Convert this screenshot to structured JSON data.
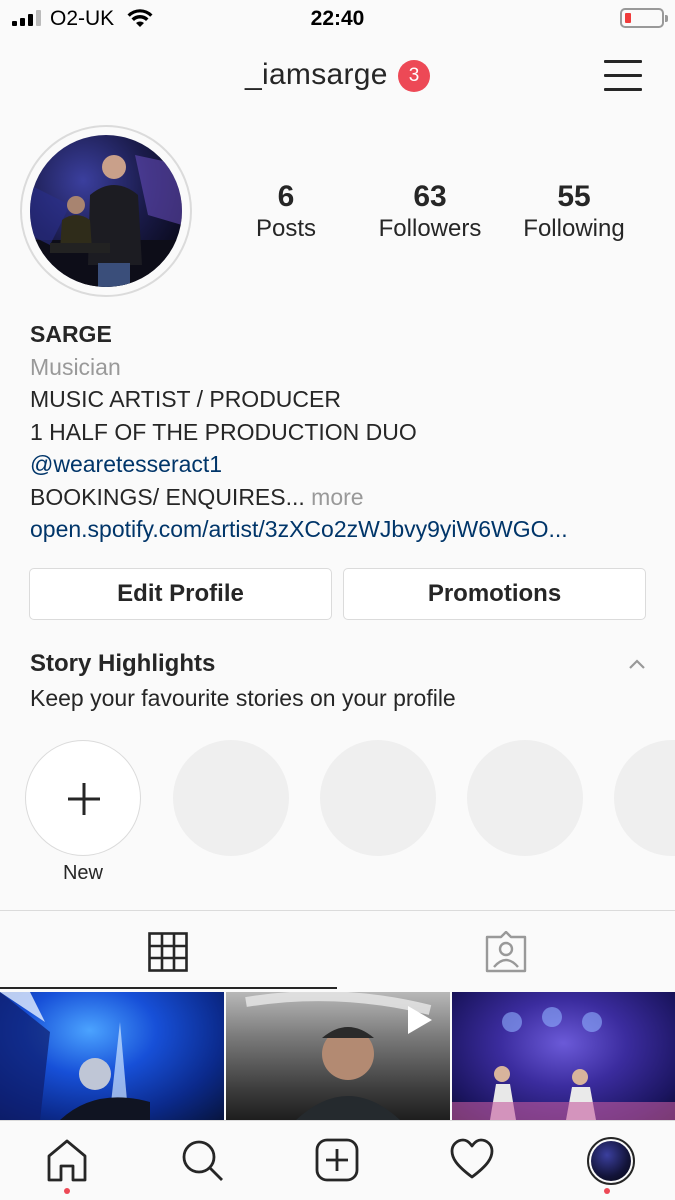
{
  "status_bar": {
    "carrier": "O2-UK",
    "time": "22:40",
    "battery_level_percent": 10,
    "battery_color": "#f03b3b"
  },
  "header": {
    "username": "_iamsarge",
    "notification_count": "3",
    "menu_icon": "hamburger-menu-icon"
  },
  "profile": {
    "stats": [
      {
        "value": "6",
        "label": "Posts"
      },
      {
        "value": "63",
        "label": "Followers"
      },
      {
        "value": "55",
        "label": "Following"
      }
    ],
    "name": "SARGE",
    "category": "Musician",
    "bio_line_1": "MUSIC ARTIST / PRODUCER",
    "bio_line_2": "1 HALF OF THE PRODUCTION DUO",
    "mention": "@wearetesseract1",
    "bio_line_3": "BOOKINGS/ ENQUIRES...",
    "more_label": "more",
    "website": "open.spotify.com/artist/3zXCo2zWJbvy9yiW6WGO..."
  },
  "buttons": {
    "edit_profile": "Edit Profile",
    "promotions": "Promotions"
  },
  "story_highlights": {
    "title": "Story Highlights",
    "subtitle": "Keep your favourite stories on your profile",
    "new_label": "New"
  },
  "tabs": {
    "grid_icon": "grid-icon",
    "tagged_icon": "tagged-photos-icon"
  },
  "nav": {
    "items": [
      "home-icon",
      "search-icon",
      "new-post-icon",
      "activity-heart-icon",
      "profile-avatar"
    ]
  },
  "colors": {
    "accent_red": "#ed4956",
    "link_blue": "#003569",
    "border": "#dbdbdb"
  }
}
